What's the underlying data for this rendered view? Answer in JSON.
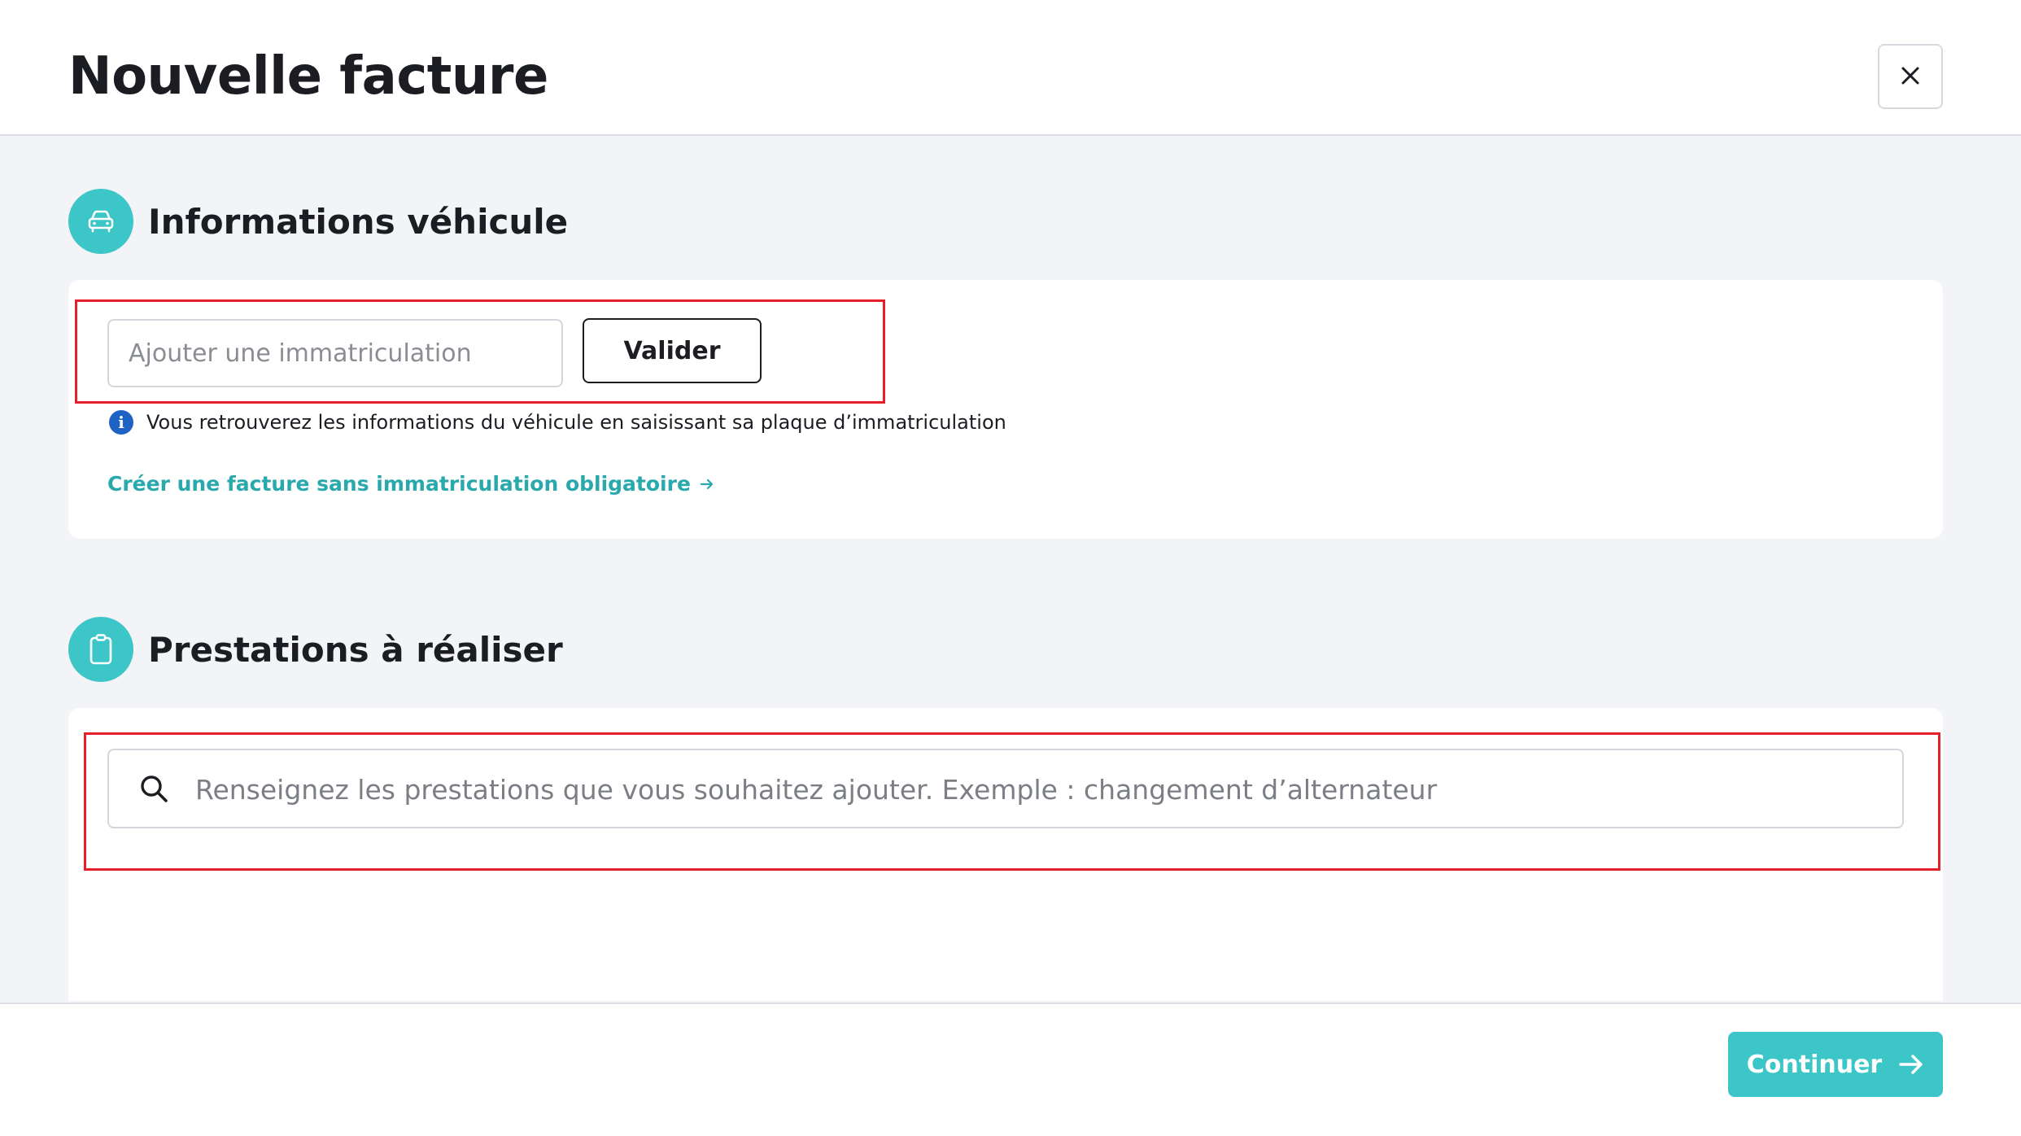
{
  "header": {
    "title": "Nouvelle facture",
    "close_icon": "close-icon"
  },
  "vehicle_section": {
    "title": "Informations véhicule",
    "icon": "car-icon",
    "plate_input": {
      "placeholder": "Ajouter une immatriculation",
      "value": ""
    },
    "validate_label": "Valider",
    "info_text": "Vous retrouverez les informations du véhicule en saisissant sa plaque d’immatriculation",
    "info_icon": "info-icon",
    "info_icon_glyph": "i",
    "no_plate_link": "Créer une facture sans immatriculation obligatoire"
  },
  "services_section": {
    "title": "Prestations à réaliser",
    "icon": "clipboard-icon",
    "search": {
      "placeholder": "Renseignez les prestations que vous souhaitez ajouter. Exemple : changement d’alternateur",
      "value": ""
    }
  },
  "footer": {
    "continue_label": "Continuer",
    "continue_icon": "arrow-right-icon"
  },
  "colors": {
    "accent": "#3cc6c8",
    "link": "#2aa9ad",
    "highlight": "#e5202a",
    "info": "#1e62c4",
    "background": "#f3f4f7"
  }
}
